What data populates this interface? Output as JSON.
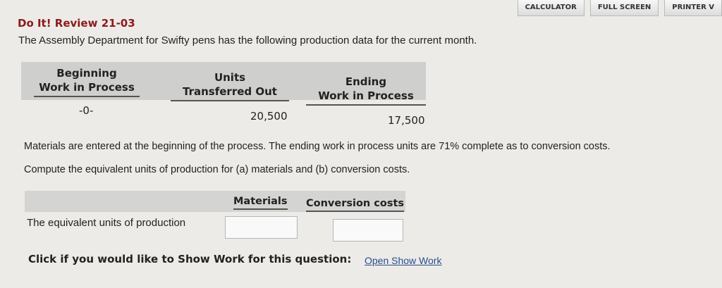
{
  "toolbar": {
    "calculator_label": "CALCULATOR",
    "fullscreen_label": "FULL SCREEN",
    "printer_label": "PRINTER V"
  },
  "question": {
    "title": "Do It! Review 21-03",
    "intro": "The Assembly Department for Swifty pens has the following production data for the current month."
  },
  "production_table": {
    "headers": [
      {
        "line1": "Beginning",
        "line2": "Work in Process"
      },
      {
        "line1": "Units",
        "line2": "Transferred Out"
      },
      {
        "line1": "Ending",
        "line2": "Work in Process"
      }
    ],
    "values": [
      "-0-",
      "20,500",
      "17,500"
    ]
  },
  "paragraphs": {
    "materials_note": "Materials are entered at the beginning of the process. The ending work in process units are 71% complete as to conversion costs.",
    "instruction": "Compute the equivalent units of production for (a) materials and (b) conversion costs."
  },
  "equivalent_table": {
    "col_materials": "Materials",
    "col_conversion": "Conversion costs",
    "row_label": "The equivalent units of production",
    "materials_value": "",
    "conversion_value": ""
  },
  "show_work": {
    "prompt": "Click if you would like to Show Work for this question:",
    "link": "Open Show Work"
  }
}
